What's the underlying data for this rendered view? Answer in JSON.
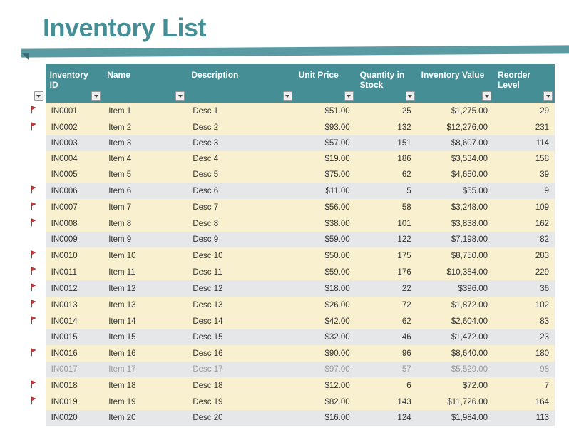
{
  "title": "Inventory List",
  "columns": {
    "flag": "",
    "id": "Inventory ID",
    "name": "Name",
    "description": "Description",
    "unit_price": "Unit Price",
    "qty": "Quantity in Stock",
    "value": "Inventory Value",
    "reorder": "Reorder Level"
  },
  "rows": [
    {
      "flag": true,
      "id": "IN0001",
      "name": "Item 1",
      "desc": "Desc 1",
      "price": "$51.00",
      "qty": "25",
      "value": "$1,275.00",
      "reorder": "29",
      "band": "a"
    },
    {
      "flag": true,
      "id": "IN0002",
      "name": "Item 2",
      "desc": "Desc 2",
      "price": "$93.00",
      "qty": "132",
      "value": "$12,276.00",
      "reorder": "231",
      "band": "a"
    },
    {
      "flag": false,
      "id": "IN0003",
      "name": "Item 3",
      "desc": "Desc 3",
      "price": "$57.00",
      "qty": "151",
      "value": "$8,607.00",
      "reorder": "114",
      "band": "b"
    },
    {
      "flag": false,
      "id": "IN0004",
      "name": "Item 4",
      "desc": "Desc 4",
      "price": "$19.00",
      "qty": "186",
      "value": "$3,534.00",
      "reorder": "158",
      "band": "a"
    },
    {
      "flag": false,
      "id": "IN0005",
      "name": "Item 5",
      "desc": "Desc 5",
      "price": "$75.00",
      "qty": "62",
      "value": "$4,650.00",
      "reorder": "39",
      "band": "a"
    },
    {
      "flag": true,
      "id": "IN0006",
      "name": "Item 6",
      "desc": "Desc 6",
      "price": "$11.00",
      "qty": "5",
      "value": "$55.00",
      "reorder": "9",
      "band": "b"
    },
    {
      "flag": true,
      "id": "IN0007",
      "name": "Item 7",
      "desc": "Desc 7",
      "price": "$56.00",
      "qty": "58",
      "value": "$3,248.00",
      "reorder": "109",
      "band": "a"
    },
    {
      "flag": true,
      "id": "IN0008",
      "name": "Item 8",
      "desc": "Desc 8",
      "price": "$38.00",
      "qty": "101",
      "value": "$3,838.00",
      "reorder": "162",
      "band": "a"
    },
    {
      "flag": false,
      "id": "IN0009",
      "name": "Item 9",
      "desc": "Desc 9",
      "price": "$59.00",
      "qty": "122",
      "value": "$7,198.00",
      "reorder": "82",
      "band": "b"
    },
    {
      "flag": true,
      "id": "IN0010",
      "name": "Item 10",
      "desc": "Desc 10",
      "price": "$50.00",
      "qty": "175",
      "value": "$8,750.00",
      "reorder": "283",
      "band": "a"
    },
    {
      "flag": true,
      "id": "IN0011",
      "name": "Item 11",
      "desc": "Desc 11",
      "price": "$59.00",
      "qty": "176",
      "value": "$10,384.00",
      "reorder": "229",
      "band": "a"
    },
    {
      "flag": true,
      "id": "IN0012",
      "name": "Item 12",
      "desc": "Desc 12",
      "price": "$18.00",
      "qty": "22",
      "value": "$396.00",
      "reorder": "36",
      "band": "b"
    },
    {
      "flag": true,
      "id": "IN0013",
      "name": "Item 13",
      "desc": "Desc 13",
      "price": "$26.00",
      "qty": "72",
      "value": "$1,872.00",
      "reorder": "102",
      "band": "a"
    },
    {
      "flag": true,
      "id": "IN0014",
      "name": "Item 14",
      "desc": "Desc 14",
      "price": "$42.00",
      "qty": "62",
      "value": "$2,604.00",
      "reorder": "83",
      "band": "a"
    },
    {
      "flag": false,
      "id": "IN0015",
      "name": "Item 15",
      "desc": "Desc 15",
      "price": "$32.00",
      "qty": "46",
      "value": "$1,472.00",
      "reorder": "23",
      "band": "b"
    },
    {
      "flag": true,
      "id": "IN0016",
      "name": "Item 16",
      "desc": "Desc 16",
      "price": "$90.00",
      "qty": "96",
      "value": "$8,640.00",
      "reorder": "180",
      "band": "a"
    },
    {
      "flag": false,
      "id": "IN0017",
      "name": "Item 17",
      "desc": "Desc 17",
      "price": "$97.00",
      "qty": "57",
      "value": "$5,529.00",
      "reorder": "98",
      "band": "b",
      "strike": true
    },
    {
      "flag": true,
      "id": "IN0018",
      "name": "Item 18",
      "desc": "Desc 18",
      "price": "$12.00",
      "qty": "6",
      "value": "$72.00",
      "reorder": "7",
      "band": "a"
    },
    {
      "flag": true,
      "id": "IN0019",
      "name": "Item 19",
      "desc": "Desc 19",
      "price": "$82.00",
      "qty": "143",
      "value": "$11,726.00",
      "reorder": "164",
      "band": "a"
    },
    {
      "flag": false,
      "id": "IN0020",
      "name": "Item 20",
      "desc": "Desc 20",
      "price": "$16.00",
      "qty": "124",
      "value": "$1,984.00",
      "reorder": "113",
      "band": "b"
    }
  ]
}
